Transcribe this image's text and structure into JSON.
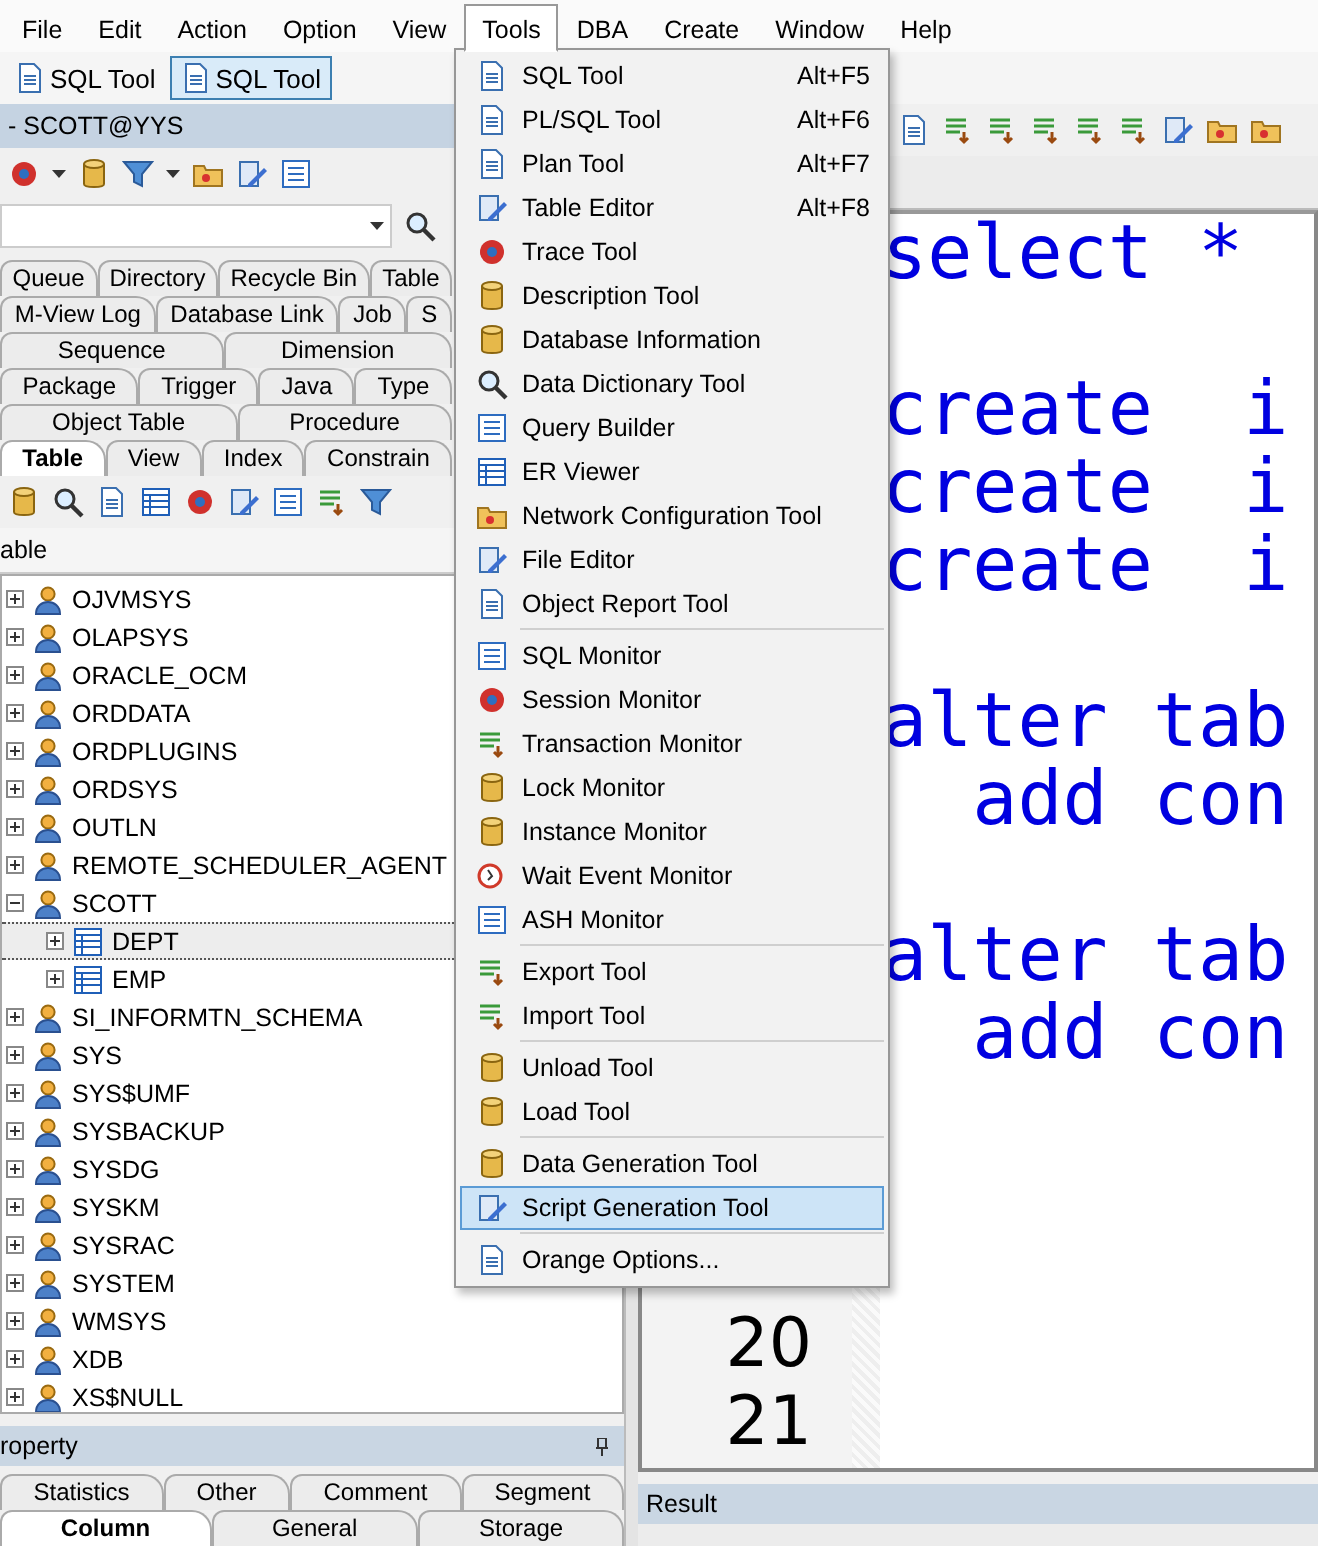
{
  "menu_bar": [
    {
      "label": "File",
      "selected": false
    },
    {
      "label": "Edit",
      "selected": false
    },
    {
      "label": "Action",
      "selected": false
    },
    {
      "label": "Option",
      "selected": false
    },
    {
      "label": "View",
      "selected": false
    },
    {
      "label": "Tools",
      "selected": true
    },
    {
      "label": "DBA",
      "selected": false
    },
    {
      "label": "Create",
      "selected": false
    },
    {
      "label": "Window",
      "selected": false
    },
    {
      "label": "Help",
      "selected": false
    }
  ],
  "document_tabs": [
    {
      "label": "SQL Tool",
      "selected": false
    },
    {
      "label": "SQL Tool",
      "selected": true
    }
  ],
  "left_panel": {
    "title": "- SCOTT@YYS",
    "object_tabs": [
      [
        {
          "label": "Queue",
          "selected": false
        },
        {
          "label": "Directory",
          "selected": false
        },
        {
          "label": "Recycle Bin",
          "selected": false
        },
        {
          "label": "Table",
          "selected": false
        }
      ],
      [
        {
          "label": "M-View Log",
          "selected": false
        },
        {
          "label": "Database Link",
          "selected": false
        },
        {
          "label": "Job",
          "selected": false
        },
        {
          "label": "S",
          "selected": false
        }
      ],
      [
        {
          "label": "Sequence",
          "selected": false
        },
        {
          "label": "Dimension",
          "selected": false
        }
      ],
      [
        {
          "label": "Package",
          "selected": false
        },
        {
          "label": "Trigger",
          "selected": false
        },
        {
          "label": "Java",
          "selected": false
        },
        {
          "label": "Type",
          "selected": false
        }
      ],
      [
        {
          "label": "Object Table",
          "selected": false
        },
        {
          "label": "Procedure",
          "selected": false
        }
      ],
      [
        {
          "label": "Table",
          "selected": true
        },
        {
          "label": "View",
          "selected": false
        },
        {
          "label": "Index",
          "selected": false
        },
        {
          "label": "Constrain",
          "selected": false
        }
      ]
    ],
    "list_header": "able",
    "tree": [
      {
        "label": "OJVMSYS",
        "kind": "user",
        "expanded": false,
        "selected": false
      },
      {
        "label": "OLAPSYS",
        "kind": "user",
        "expanded": false,
        "selected": false
      },
      {
        "label": "ORACLE_OCM",
        "kind": "user",
        "expanded": false,
        "selected": false
      },
      {
        "label": "ORDDATA",
        "kind": "user",
        "expanded": false,
        "selected": false
      },
      {
        "label": "ORDPLUGINS",
        "kind": "user",
        "expanded": false,
        "selected": false
      },
      {
        "label": "ORDSYS",
        "kind": "user",
        "expanded": false,
        "selected": false
      },
      {
        "label": "OUTLN",
        "kind": "user",
        "expanded": false,
        "selected": false
      },
      {
        "label": "REMOTE_SCHEDULER_AGENT",
        "kind": "user",
        "expanded": false,
        "selected": false
      },
      {
        "label": "SCOTT",
        "kind": "user",
        "expanded": true,
        "selected": false,
        "children": [
          {
            "label": "DEPT",
            "kind": "table",
            "expanded": false,
            "selected": true
          },
          {
            "label": "EMP",
            "kind": "table",
            "expanded": false,
            "selected": false
          }
        ]
      },
      {
        "label": "SI_INFORMTN_SCHEMA",
        "kind": "user",
        "expanded": false,
        "selected": false
      },
      {
        "label": "SYS",
        "kind": "user",
        "expanded": false,
        "selected": false
      },
      {
        "label": "SYS$UMF",
        "kind": "user",
        "expanded": false,
        "selected": false
      },
      {
        "label": "SYSBACKUP",
        "kind": "user",
        "expanded": false,
        "selected": false
      },
      {
        "label": "SYSDG",
        "kind": "user",
        "expanded": false,
        "selected": false
      },
      {
        "label": "SYSKM",
        "kind": "user",
        "expanded": false,
        "selected": false
      },
      {
        "label": "SYSRAC",
        "kind": "user",
        "expanded": false,
        "selected": false
      },
      {
        "label": "SYSTEM",
        "kind": "user",
        "expanded": false,
        "selected": false
      },
      {
        "label": "WMSYS",
        "kind": "user",
        "expanded": false,
        "selected": false
      },
      {
        "label": "XDB",
        "kind": "user",
        "expanded": false,
        "selected": false
      },
      {
        "label": "XS$NULL",
        "kind": "user",
        "expanded": false,
        "selected": false
      }
    ],
    "property_title": "roperty",
    "property_tabs": [
      [
        {
          "label": "Statistics",
          "selected": false
        },
        {
          "label": "Other",
          "selected": false
        },
        {
          "label": "Comment",
          "selected": false
        },
        {
          "label": "Segment",
          "selected": false
        }
      ],
      [
        {
          "label": "Column",
          "selected": true
        },
        {
          "label": "General",
          "selected": false
        },
        {
          "label": "Storage",
          "selected": false
        }
      ]
    ]
  },
  "editor": {
    "lines": [
      {
        "kind": "code",
        "code": "select *"
      },
      {
        "kind": "blank"
      },
      {
        "kind": "code",
        "code": "create  i"
      },
      {
        "kind": "code",
        "code": "create  i"
      },
      {
        "kind": "code",
        "code": "create  i"
      },
      {
        "kind": "blank"
      },
      {
        "kind": "code",
        "code": "alter tab"
      },
      {
        "kind": "code",
        "code": "  add con"
      },
      {
        "kind": "blank"
      },
      {
        "kind": "code",
        "code": "alter tab"
      },
      {
        "kind": "code",
        "code": "  add con"
      },
      {
        "kind": "blank"
      },
      {
        "kind": "blank"
      },
      {
        "kind": "blank"
      },
      {
        "kind": "numbered",
        "number": "20"
      },
      {
        "kind": "numbered",
        "number": "21"
      }
    ]
  },
  "result_title": "Result",
  "tools_menu": {
    "groups": [
      [
        {
          "label": "SQL Tool",
          "shortcut": "Alt+F5",
          "selected": false
        },
        {
          "label": "PL/SQL Tool",
          "shortcut": "Alt+F6",
          "selected": false
        },
        {
          "label": "Plan Tool",
          "shortcut": "Alt+F7",
          "selected": false
        },
        {
          "label": "Table Editor",
          "shortcut": "Alt+F8",
          "selected": false
        },
        {
          "label": "Trace Tool",
          "selected": false
        },
        {
          "label": "Description Tool",
          "selected": false
        },
        {
          "label": "Database Information",
          "selected": false
        },
        {
          "label": "Data Dictionary Tool",
          "selected": false
        },
        {
          "label": "Query Builder",
          "selected": false
        },
        {
          "label": "ER Viewer",
          "selected": false
        },
        {
          "label": "Network Configuration Tool",
          "selected": false
        },
        {
          "label": "File Editor",
          "selected": false
        },
        {
          "label": "Object Report Tool",
          "selected": false
        }
      ],
      [
        {
          "label": "SQL Monitor",
          "selected": false
        },
        {
          "label": "Session Monitor",
          "selected": false
        },
        {
          "label": "Transaction Monitor",
          "selected": false
        },
        {
          "label": "Lock Monitor",
          "selected": false
        },
        {
          "label": "Instance Monitor",
          "selected": false
        },
        {
          "label": "Wait Event Monitor",
          "selected": false
        },
        {
          "label": "ASH Monitor",
          "selected": false
        }
      ],
      [
        {
          "label": "Export Tool",
          "selected": false
        },
        {
          "label": "Import Tool",
          "selected": false
        }
      ],
      [
        {
          "label": "Unload Tool",
          "selected": false
        },
        {
          "label": "Load Tool",
          "selected": false
        }
      ],
      [
        {
          "label": "Data Generation Tool",
          "selected": false
        },
        {
          "label": "Script Generation Tool",
          "selected": true
        }
      ],
      [
        {
          "label": "Orange Options...",
          "selected": false
        }
      ]
    ]
  }
}
